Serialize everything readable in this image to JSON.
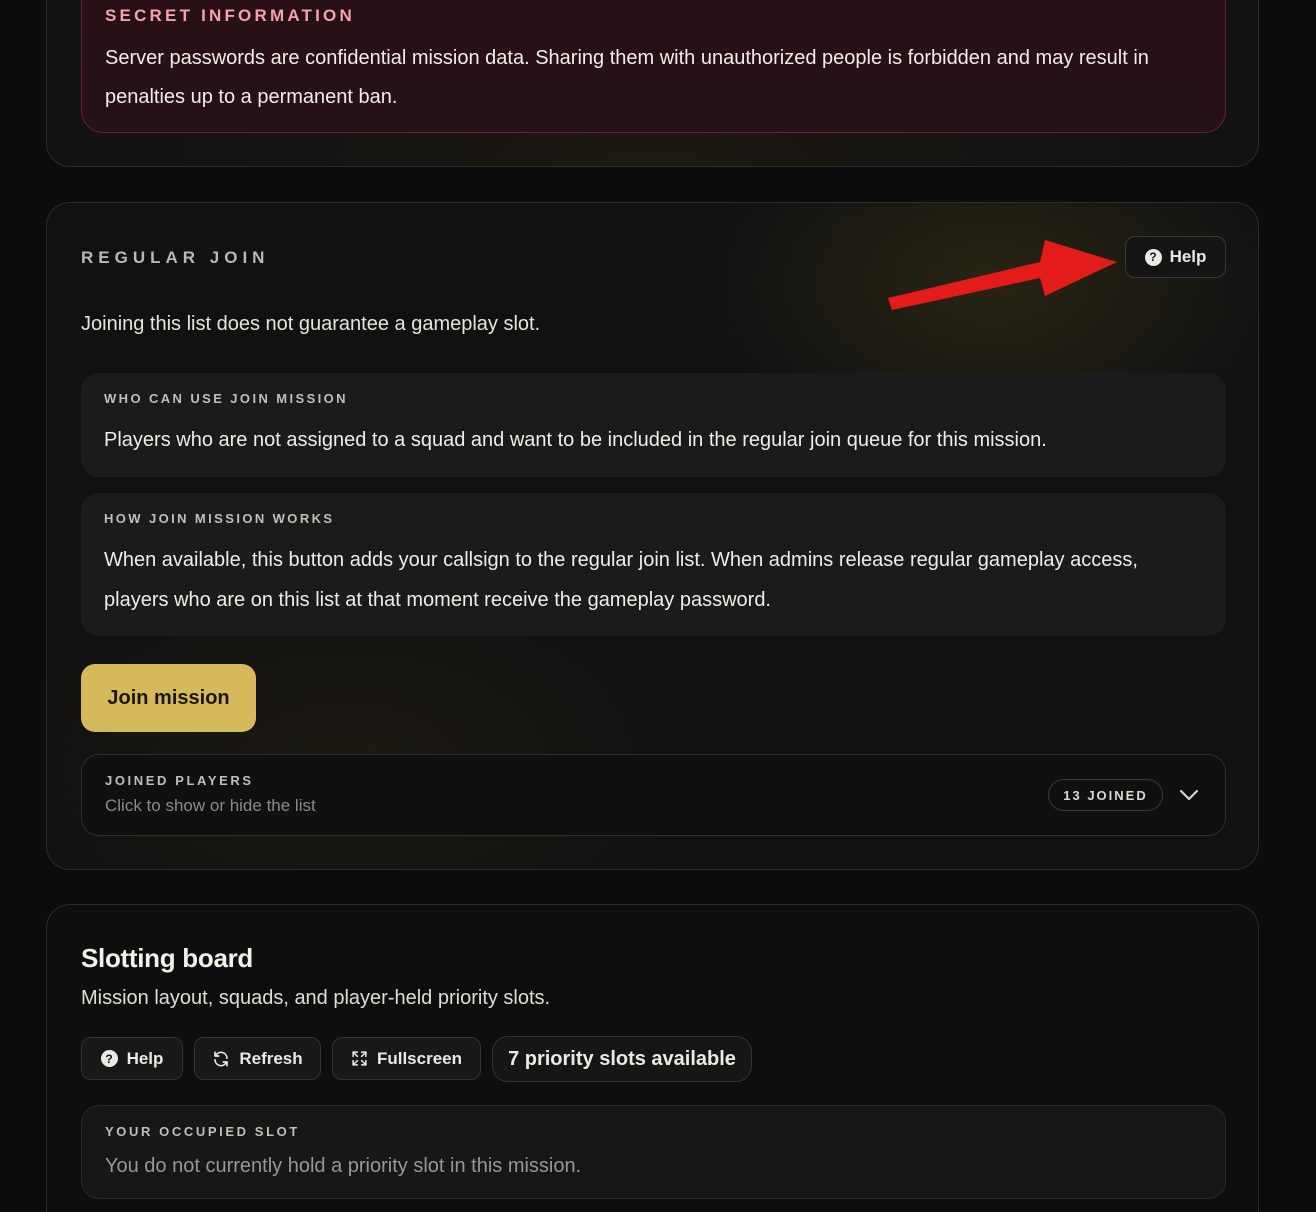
{
  "secret": {
    "title": "SECRET INFORMATION",
    "text": "Server passwords are confidential mission data. Sharing them with unauthorized people is forbidden and may result in penalties up to a permanent ban."
  },
  "regular_join": {
    "title": "REGULAR JOIN",
    "help_label": "Help",
    "subtitle": "Joining this list does not guarantee a gameplay slot.",
    "who": {
      "label": "WHO CAN USE JOIN MISSION",
      "text": "Players who are not assigned to a squad and want to be included in the regular join queue for this mission."
    },
    "how": {
      "label": "HOW JOIN MISSION WORKS",
      "text": "When available, this button adds your callsign to the regular join list. When admins release regular gameplay access, players who are on this list at that moment receive the gameplay password."
    },
    "join_button": "Join mission",
    "joined_players": {
      "label": "JOINED PLAYERS",
      "hint": "Click to show or hide the list",
      "badge": "13 JOINED"
    }
  },
  "slotting_board": {
    "title": "Slotting board",
    "subtitle": "Mission layout, squads, and player-held priority slots.",
    "toolbar": {
      "help": "Help",
      "refresh": "Refresh",
      "fullscreen": "Fullscreen",
      "priority": "7 priority slots available"
    },
    "occupied": {
      "label": "YOUR OCCUPIED SLOT",
      "text": "You do not currently hold a priority slot in this mission."
    }
  },
  "icons": {
    "help": "question-circle-icon",
    "refresh": "refresh-icon",
    "fullscreen": "expand-icon",
    "toggle": "chevron-down-icon",
    "annotation": "red-arrow-icon"
  },
  "colors": {
    "accent": "#d6b95a",
    "danger_border": "#6a2430",
    "danger_title": "#f3a3ad",
    "annotation_arrow": "#e31b1b"
  }
}
